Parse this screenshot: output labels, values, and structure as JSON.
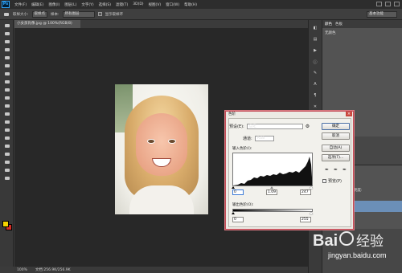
{
  "app": {
    "logo": "Ps"
  },
  "menu": [
    "文件(F)",
    "编辑(E)",
    "图像(I)",
    "图层(L)",
    "文字(Y)",
    "选择(S)",
    "滤镜(T)",
    "3D(D)",
    "视图(V)",
    "窗口(W)",
    "帮助(H)"
  ],
  "options_bar": {
    "brush_label": "取样大小:",
    "sample_select": "取样点",
    "sample_label": "样本:",
    "layer_select": "所有图层",
    "show_ring": "显示取样环",
    "workspace": "基本功能"
  },
  "document": {
    "tab_title": "小女孩肖像.jpg @ 100%(RGB/8)",
    "zoom": "100%",
    "doc_size": "文档:256.9K/256.9K"
  },
  "right_panels": {
    "tabs": [
      "颜色",
      "色板"
    ],
    "content": "无颜色",
    "layers_label": "不透明度:"
  },
  "curves_dialog": {
    "title": "色阶",
    "preset_label": "预设(E):",
    "preset_value": "自定",
    "channel_label": "通道:",
    "channel_value": "RGB",
    "input_levels_label": "输入色阶(I):",
    "input_black": "0",
    "input_gamma": "1.09",
    "input_white": "247",
    "output_levels_label": "输出色阶(O):",
    "output_black": "0",
    "output_white": "255",
    "buttons": {
      "ok": "确定",
      "cancel": "取消",
      "auto": "自动(A)",
      "options": "选项(T)..."
    },
    "preview_label": "预览(P)",
    "preview_checked": true
  },
  "watermark": {
    "brand": "Bai 经验",
    "url": "jingyan.baidu.com"
  },
  "colors": {
    "accent": "#c34a55",
    "fg_swatch": "#f4d400",
    "bg_swatch": "#d22d25",
    "canvas_bg": "#282828"
  }
}
